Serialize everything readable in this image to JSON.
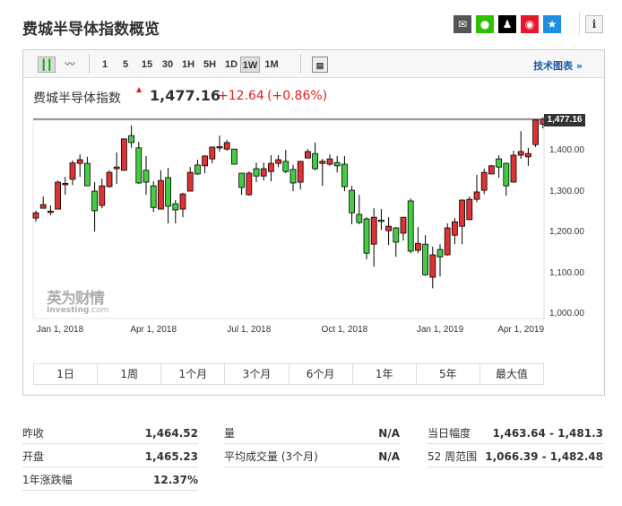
{
  "title": "费城半导体指数概览",
  "share_icons": [
    {
      "name": "email-icon",
      "color": "#555555",
      "glyph": "✉"
    },
    {
      "name": "wechat-icon",
      "color": "#2dc100",
      "glyph": "●"
    },
    {
      "name": "qq-icon",
      "color": "#000000",
      "glyph": "♟"
    },
    {
      "name": "weibo-icon",
      "color": "#e6162d",
      "glyph": "◉"
    },
    {
      "name": "qzone-icon",
      "color": "#1e8fe0",
      "glyph": "★"
    }
  ],
  "info_glyph": "i",
  "toolbar": {
    "intervals": [
      "1",
      "5",
      "15",
      "30",
      "1H",
      "5H",
      "1D",
      "1W",
      "1M"
    ],
    "selected": "1W",
    "tech_chart": "技术图表 »"
  },
  "quote": {
    "name": "费城半导体指数",
    "price": "1,477.16",
    "change": "+12.64",
    "change_pct": "(+0.86%)",
    "up_color": "#e02020"
  },
  "logo": {
    "cn": "英为财情",
    "en": "Investing.com"
  },
  "chart_data": {
    "type": "candlestick",
    "current_label": "1,477.16",
    "ylim": [
      1000,
      1475
    ],
    "y_ticks": [
      {
        "v": 1000,
        "label": "1,000.00"
      },
      {
        "v": 1100,
        "label": "1,100.00"
      },
      {
        "v": 1200,
        "label": "1,200.00"
      },
      {
        "v": 1300,
        "label": "1,300.00"
      },
      {
        "v": 1400,
        "label": "1,400.00"
      }
    ],
    "x_ticks": [
      {
        "i": 3.3,
        "label": "Jan 1, 2018"
      },
      {
        "i": 16,
        "label": "Apr 1, 2018"
      },
      {
        "i": 29,
        "label": "Jul 1, 2018"
      },
      {
        "i": 42,
        "label": "Oct 1, 2018"
      },
      {
        "i": 55,
        "label": "Jan 1, 2019"
      },
      {
        "i": 66,
        "label": "Apr 1, 2019"
      }
    ],
    "current": 1477.16,
    "up_color": "#dd3333",
    "down_color": "#44cc44",
    "ohlc": [
      [
        1235,
        1253,
        1226,
        1248
      ],
      [
        1259,
        1288,
        1259,
        1268
      ],
      [
        1250,
        1266,
        1242,
        1252
      ],
      [
        1257,
        1327,
        1257,
        1323
      ],
      [
        1318,
        1336,
        1292,
        1320
      ],
      [
        1330,
        1376,
        1316,
        1370
      ],
      [
        1369,
        1391,
        1336,
        1378
      ],
      [
        1369,
        1385,
        1314,
        1314
      ],
      [
        1301,
        1323,
        1202,
        1253
      ],
      [
        1266,
        1332,
        1259,
        1314
      ],
      [
        1312,
        1352,
        1310,
        1347
      ],
      [
        1356,
        1396,
        1319,
        1360
      ],
      [
        1352,
        1429,
        1352,
        1429
      ],
      [
        1437,
        1462,
        1407,
        1420
      ],
      [
        1407,
        1422,
        1319,
        1321
      ],
      [
        1352,
        1387,
        1292,
        1323
      ],
      [
        1314,
        1325,
        1250,
        1261
      ],
      [
        1257,
        1352,
        1257,
        1327
      ],
      [
        1334,
        1358,
        1222,
        1264
      ],
      [
        1270,
        1279,
        1222,
        1255
      ],
      [
        1257,
        1297,
        1237,
        1294
      ],
      [
        1301,
        1360,
        1301,
        1347
      ],
      [
        1365,
        1378,
        1341,
        1343
      ],
      [
        1363,
        1389,
        1345,
        1387
      ],
      [
        1380,
        1409,
        1369,
        1409
      ],
      [
        1408,
        1437,
        1398,
        1410
      ],
      [
        1404,
        1426,
        1400,
        1420
      ],
      [
        1404,
        1404,
        1367,
        1367
      ],
      [
        1345,
        1345,
        1292,
        1310
      ],
      [
        1292,
        1349,
        1290,
        1345
      ],
      [
        1356,
        1371,
        1323,
        1338
      ],
      [
        1338,
        1371,
        1327,
        1356
      ],
      [
        1349,
        1389,
        1325,
        1369
      ],
      [
        1369,
        1389,
        1360,
        1378
      ],
      [
        1374,
        1402,
        1345,
        1349
      ],
      [
        1354,
        1365,
        1301,
        1321
      ],
      [
        1323,
        1374,
        1305,
        1374
      ],
      [
        1382,
        1404,
        1382,
        1398
      ],
      [
        1393,
        1420,
        1352,
        1356
      ],
      [
        1369,
        1380,
        1314,
        1374
      ],
      [
        1367,
        1391,
        1363,
        1380
      ],
      [
        1371,
        1387,
        1347,
        1363
      ],
      [
        1367,
        1387,
        1301,
        1312
      ],
      [
        1303,
        1314,
        1220,
        1248
      ],
      [
        1244,
        1292,
        1220,
        1224
      ],
      [
        1233,
        1237,
        1134,
        1149
      ],
      [
        1171,
        1259,
        1116,
        1237
      ],
      [
        1230,
        1257,
        1206,
        1228
      ],
      [
        1204,
        1237,
        1169,
        1215
      ],
      [
        1211,
        1213,
        1140,
        1176
      ],
      [
        1198,
        1237,
        1180,
        1237
      ],
      [
        1277,
        1283,
        1149,
        1154
      ],
      [
        1156,
        1213,
        1149,
        1173
      ],
      [
        1171,
        1193,
        1094,
        1096
      ],
      [
        1090,
        1165,
        1063,
        1145
      ],
      [
        1158,
        1171,
        1092,
        1140
      ],
      [
        1145,
        1222,
        1143,
        1211
      ],
      [
        1193,
        1235,
        1171,
        1226
      ],
      [
        1215,
        1281,
        1171,
        1279
      ],
      [
        1231,
        1288,
        1231,
        1281
      ],
      [
        1281,
        1341,
        1274,
        1299
      ],
      [
        1303,
        1356,
        1294,
        1347
      ],
      [
        1343,
        1365,
        1343,
        1363
      ],
      [
        1380,
        1389,
        1334,
        1360
      ],
      [
        1369,
        1371,
        1290,
        1314
      ],
      [
        1323,
        1400,
        1323,
        1389
      ],
      [
        1389,
        1448,
        1380,
        1398
      ],
      [
        1385,
        1407,
        1363,
        1393
      ],
      [
        1415,
        1475,
        1409,
        1475
      ],
      [
        1465,
        1482,
        1455,
        1477
      ]
    ]
  },
  "ranges": [
    "1日",
    "1周",
    "1个月",
    "3个月",
    "6个月",
    "1年",
    "5年",
    "最大值"
  ],
  "stats": [
    {
      "label": "昨收",
      "value": "1,464.52"
    },
    {
      "label": "量",
      "value": "N/A"
    },
    {
      "label": "当日幅度",
      "value": "1,463.64 - 1,481.3"
    },
    {
      "label": "开盘",
      "value": "1,465.23"
    },
    {
      "label": "平均成交量 (3个月)",
      "value": "N/A"
    },
    {
      "label": "52 周范围",
      "value": "1,066.39 - 1,482.48"
    },
    {
      "label": "1年涨跌幅",
      "value": "12.37%"
    }
  ]
}
